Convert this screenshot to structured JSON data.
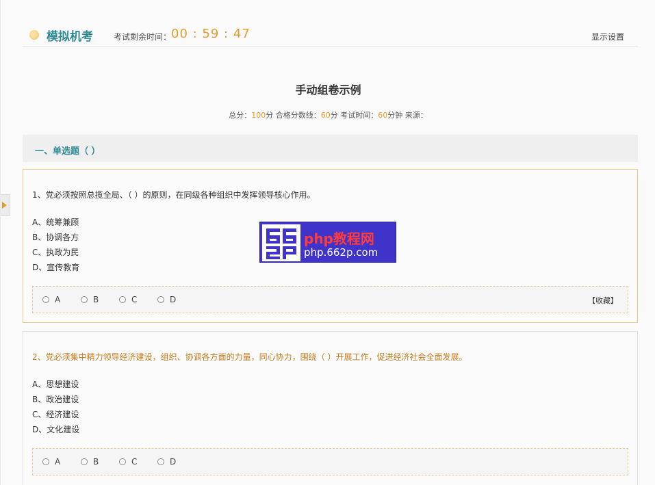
{
  "header": {
    "brand": "模拟机考",
    "timer_label": "考试剩余时间：",
    "timer": "00 : 59 : 47",
    "display_settings": "显示设置"
  },
  "paper": {
    "title": "手动组卷示例",
    "meta": {
      "total_label": "总分：",
      "total": "100",
      "pass_label": "分 合格分数线：",
      "pass": "60",
      "time_label": "分 考试时间：",
      "time": "60",
      "time_unit": "分钟 来源："
    }
  },
  "section": {
    "title": "一、单选题（ ）"
  },
  "questions": [
    {
      "text": "1、党必须按照总揽全局、（ ）的原则，在同级各种组织中发挥领导核心作用。",
      "options": [
        "A、统筹兼顾",
        "B、协调各方",
        "C、执政为民",
        "D、宣传教育"
      ],
      "choices": [
        "A",
        "B",
        "C",
        "D"
      ],
      "collect": "【收藏】"
    },
    {
      "text": "2、党必须集中精力领导经济建设，组织、协调各方面的力量，同心协力，围绕（ ）开展工作，促进经济社会全面发展。",
      "options": [
        "A、思想建设",
        "B、政治建设",
        "C、经济建设",
        "D、文化建设"
      ],
      "choices": [
        "A",
        "B",
        "C",
        "D"
      ]
    }
  ],
  "watermark": {
    "line1": "php教程网",
    "line2": "php.662p.com",
    "colors": {
      "background": "#3f33c9",
      "line1": "#ff3c3c",
      "line2": "#ffffff"
    }
  },
  "colors": {
    "accent_teal": "#2e8a94",
    "accent_orange": "#e89a2c"
  }
}
